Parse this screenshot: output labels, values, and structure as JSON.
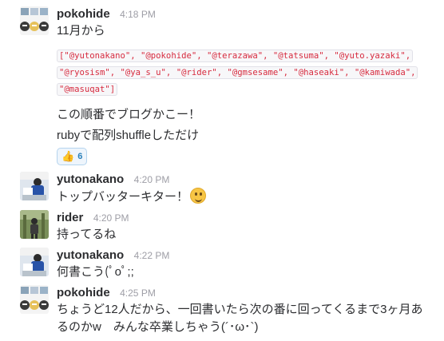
{
  "messages": [
    {
      "author": "pokohide",
      "time": "4:18 PM",
      "lines": [
        "11月から"
      ],
      "code": [
        "[\"@yutonakano\", \"@pokohide\", \"@terazawa\", \"@tatsuma\", \"@yuto.yazaki\",",
        "\"@ryosism\", \"@ya_s_u\", \"@rider\", \"@gmsesame\", \"@haseaki\", \"@kamiwada\",",
        "\"@masuqat\"]"
      ],
      "after_lines": [
        "この順番でブログかこー！",
        "rubyで配列shuffleしただけ"
      ],
      "reaction": {
        "icon": "thumbs-up-icon",
        "emoji": "👍",
        "count": "6"
      }
    },
    {
      "author": "yutonakano",
      "time": "4:20 PM",
      "text": "トップバッターキター！",
      "emoji": "upside-down-face-icon"
    },
    {
      "author": "rider",
      "time": "4:20 PM",
      "text": "持ってるね"
    },
    {
      "author": "yutonakano",
      "time": "4:22 PM",
      "text": "何書こう(ﾟoﾟ;;"
    },
    {
      "author": "pokohide",
      "time": "4:25 PM",
      "lines": [
        "ちょうど12人だから、一回書いたら次の番に回ってくるまで3ヶ月あ",
        "るのかw　みんな卒業しちゃう(´･ω･`)"
      ]
    }
  ],
  "colors": {
    "author": "#2c2d30",
    "time": "#9e9ea6",
    "code": "#d72b3f",
    "reaction_border": "#b5d4ee"
  }
}
